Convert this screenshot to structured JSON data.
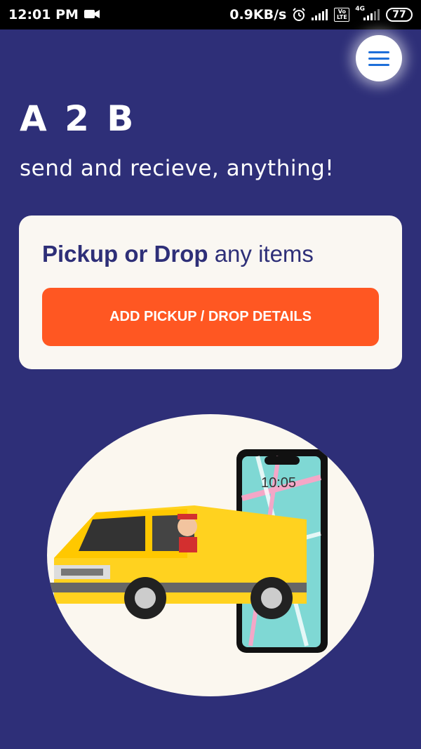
{
  "status_bar": {
    "time": "12:01 PM",
    "network_speed": "0.9KB/s",
    "network_type": "4G",
    "volte": "Vo LTE",
    "battery": "77"
  },
  "header": {
    "title": "A 2 B",
    "tagline": "send and recieve, anything!"
  },
  "card": {
    "heading_strong": "Pickup or Drop",
    "heading_rest": " any items",
    "button_label": "ADD PICKUP / DROP DETAILS"
  },
  "illustration": {
    "phone_time": "10:05"
  },
  "colors": {
    "background": "#2e2f78",
    "accent": "#ff5722",
    "card": "#faf7f2",
    "menu_icon": "#1e6fd9"
  },
  "icons": [
    "video-camera-icon",
    "alarm-icon",
    "signal-icon",
    "battery-icon",
    "menu-icon"
  ]
}
